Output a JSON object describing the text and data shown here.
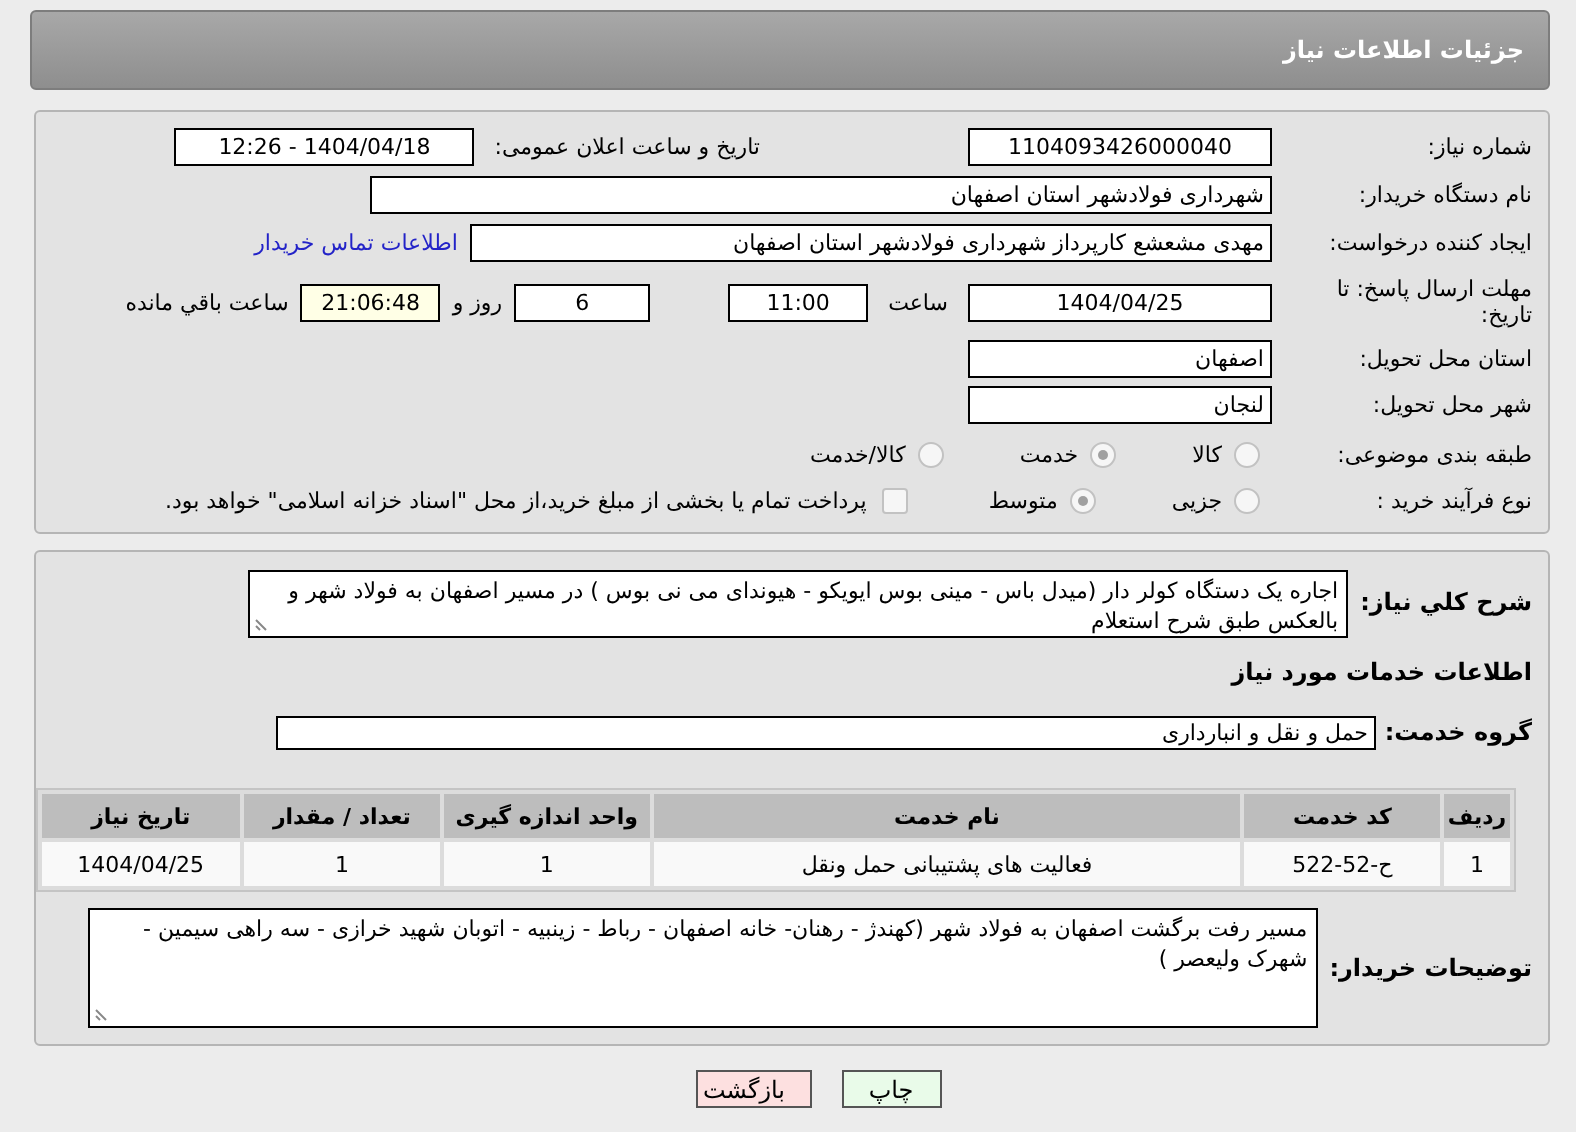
{
  "header": {
    "title": "جزئیات اطلاعات نیاز"
  },
  "need_number": {
    "label": "شماره نیاز:",
    "value": "1104093426000040"
  },
  "announce": {
    "label": "تاریخ و ساعت اعلان عمومی:",
    "value": "1404/04/18 - 12:26"
  },
  "buyer": {
    "label": "نام دستگاه خریدار:",
    "value": "شهرداری فولادشهر استان اصفهان"
  },
  "creator": {
    "label": "ایجاد کننده درخواست:",
    "value": "مهدی مشعشع کارپرداز شهرداری فولادشهر استان اصفهان",
    "contact_link": "اطلاعات تماس خریدار"
  },
  "deadline": {
    "label": "مهلت ارسال پاسخ: تا تاریخ:",
    "date": "1404/04/25",
    "time_label": "ساعت",
    "time": "11:00",
    "days": "6",
    "days_label": "روز و",
    "remaining": "21:06:48",
    "remaining_label": "ساعت باقي مانده"
  },
  "province": {
    "label": "استان محل تحویل:",
    "value": "اصفهان"
  },
  "city": {
    "label": "شهر محل تحویل:",
    "value": "لنجان"
  },
  "category": {
    "label": "طبقه بندی موضوعی:",
    "options": [
      {
        "label": "کالا",
        "selected": false
      },
      {
        "label": "خدمت",
        "selected": true
      },
      {
        "label": "کالا/خدمت",
        "selected": false
      }
    ]
  },
  "process": {
    "label": "نوع فرآیند خرید :",
    "options": [
      {
        "label": "جزیی",
        "selected": false
      },
      {
        "label": "متوسط",
        "selected": true
      }
    ],
    "treasury": {
      "checked": false,
      "label": "پرداخت تمام یا بخشی از مبلغ خرید،از محل \"اسناد خزانه اسلامی\" خواهد بود."
    }
  },
  "description": {
    "label": "شرح کلي نياز:",
    "value": "اجاره یک دستگاه کولر دار (میدل باس - مینی بوس ایویکو - هیوندای می نی بوس ) در مسیر اصفهان به فولاد شهر و بالعکس طبق شرح استعلام"
  },
  "services_heading": "اطلاعات خدمات مورد نیاز",
  "service_group": {
    "label": "گروه خدمت:",
    "value": "حمل و نقل و انبارداری"
  },
  "table": {
    "columns": [
      "ردیف",
      "کد خدمت",
      "نام خدمت",
      "واحد اندازه گیری",
      "تعداد / مقدار",
      "تاریخ نیاز"
    ],
    "rows": [
      [
        "1",
        "ح-52-522",
        "فعالیت های پشتیبانی حمل ونقل",
        "1",
        "1",
        "1404/04/25"
      ]
    ]
  },
  "buyer_notes": {
    "label": "توضیحات خریدار:",
    "value": "مسیر رفت برگشت  اصفهان به فولاد شهر (کهندژ - رهنان- خانه اصفهان - رباط - زینبیه - اتوبان شهید خرازی - سه راهی سیمین - شهرک ولیعصر )"
  },
  "buttons": [
    {
      "label": "چاپ",
      "kind": "print"
    },
    {
      "label": "بازگشت",
      "kind": "back"
    }
  ]
}
